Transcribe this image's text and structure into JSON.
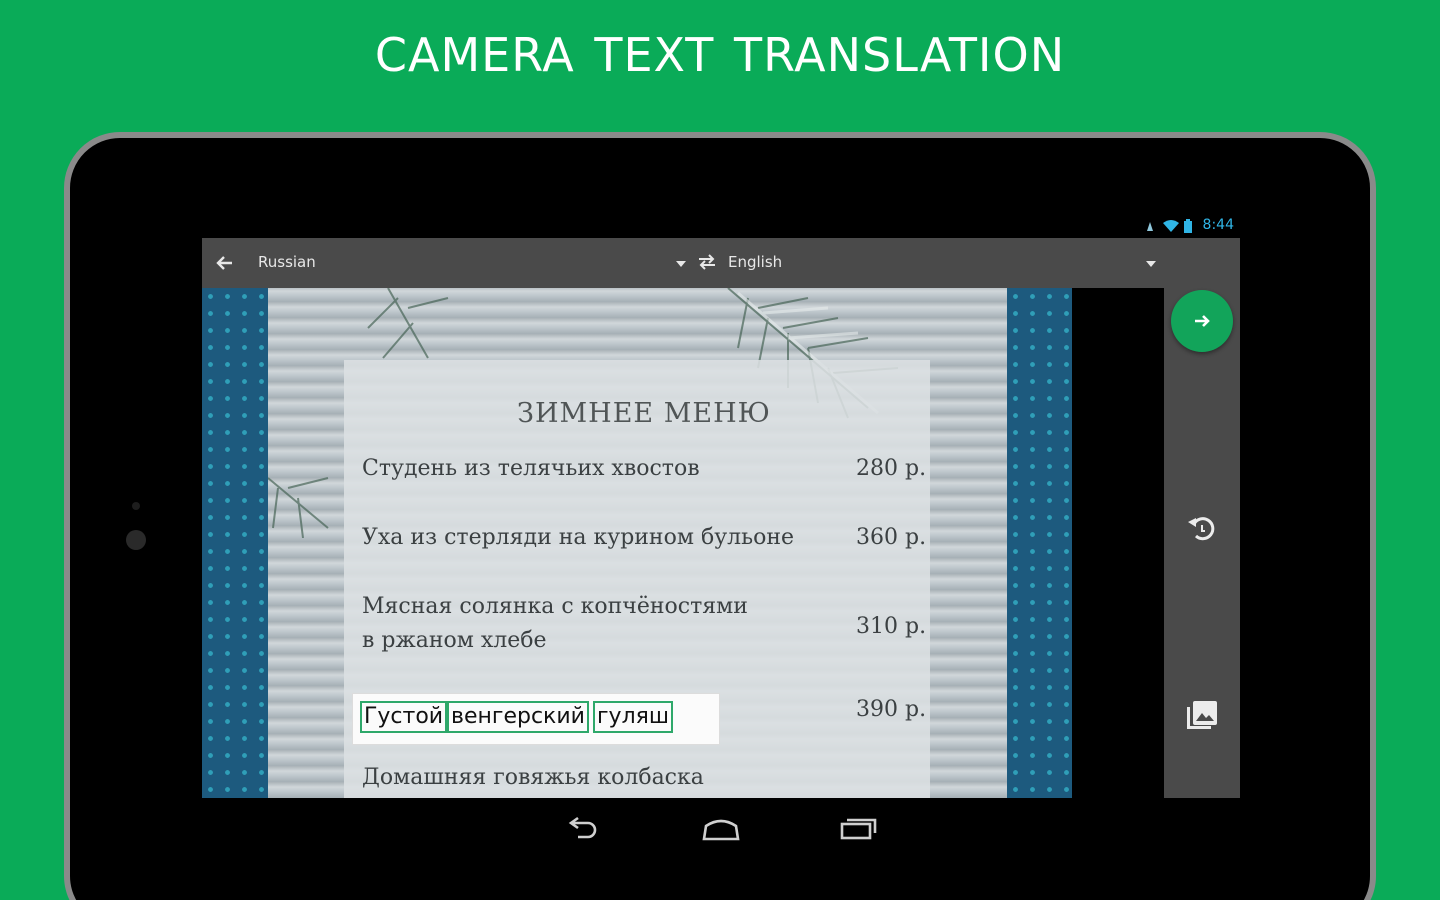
{
  "headline": "CAMERA TEXT  TRANSLATION",
  "status_bar": {
    "time": "8:44",
    "icons": [
      "alarm-icon",
      "wifi-icon",
      "battery-icon"
    ]
  },
  "toolbar": {
    "source_language": "Russian",
    "target_language": "English",
    "icons": [
      "back-arrow-icon",
      "dropdown-arrow-icon",
      "swap-languages-icon"
    ]
  },
  "camera_view": {
    "menu_title": "ЗИМНЕЕ МЕНЮ",
    "items": [
      {
        "name": "Студень из телячьих хвостов",
        "price": "280 р."
      },
      {
        "name": "Уха из стерляди на курином бульоне",
        "price": "360 р."
      },
      {
        "name_line1": "Мясная солянка с копчёностями",
        "name_line2": "в ржаном хлебе",
        "price": "310 р."
      },
      {
        "price": "390 р."
      },
      {
        "name": "Домашняя говяжья колбаска"
      }
    ],
    "recognized_words": [
      "Густой",
      "венгерский",
      "гуляш"
    ]
  },
  "side_panel": {
    "icons": [
      "translate-arrow-icon",
      "rotate-icon",
      "gallery-icon"
    ]
  },
  "nav_bar": {
    "icons": [
      "back-icon",
      "home-icon",
      "recents-icon"
    ]
  },
  "colors": {
    "brand_green": "#0aab58",
    "fab_green": "#12a45a",
    "toolbar_gray": "#4a4a4a",
    "ocr_highlight": "#2ea86a"
  }
}
